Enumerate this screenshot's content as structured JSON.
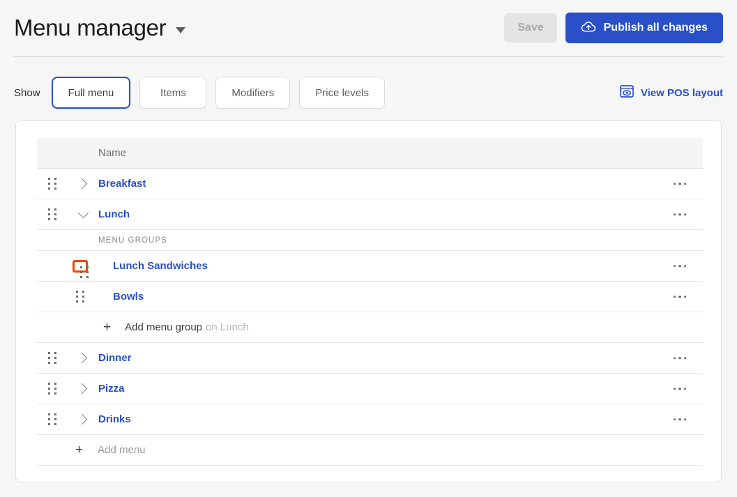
{
  "header": {
    "title": "Menu manager",
    "title_caret_icon": "caret-down-icon",
    "save_label": "Save",
    "publish_label": "Publish all changes",
    "publish_icon": "cloud-upload-icon",
    "accent_color": "#2a50c8",
    "highlight_color": "#e8490d"
  },
  "showbar": {
    "label": "Show",
    "tabs": [
      {
        "label": "Full menu",
        "active": true
      },
      {
        "label": "Items",
        "active": false
      },
      {
        "label": "Modifiers",
        "active": false
      },
      {
        "label": "Price levels",
        "active": false
      }
    ],
    "pos_link": "View POS layout",
    "pos_icon": "eye-in-window-icon"
  },
  "table": {
    "columns": [
      "Name"
    ],
    "group_label": "MENU GROUPS",
    "overflow_icon": "ellipsis-icon",
    "rows": [
      {
        "name": "Breakfast",
        "chevron": "right",
        "drag": "drag-handle-icon",
        "overflow": true
      },
      {
        "name": "Lunch",
        "chevron": "down",
        "drag": "drag-handle-icon",
        "overflow": true
      }
    ],
    "children": [
      {
        "name": "Lunch Sandwiches",
        "drag": "drag-handle-icon",
        "highlighted": true,
        "overflow": true
      },
      {
        "name": "Bowls",
        "drag": "drag-handle-icon",
        "highlighted": false,
        "overflow": true
      }
    ],
    "add_group": {
      "plus": "+",
      "text": "Add menu group",
      "sub": "on Lunch"
    },
    "rows_after": [
      {
        "name": "Dinner",
        "chevron": "right",
        "drag": "drag-handle-icon",
        "overflow": true
      },
      {
        "name": "Pizza",
        "chevron": "right",
        "drag": "drag-handle-icon",
        "overflow": true
      },
      {
        "name": "Drinks",
        "chevron": "right",
        "drag": "drag-handle-icon",
        "overflow": true
      }
    ],
    "add_menu": {
      "plus": "+",
      "text": "Add menu"
    }
  }
}
